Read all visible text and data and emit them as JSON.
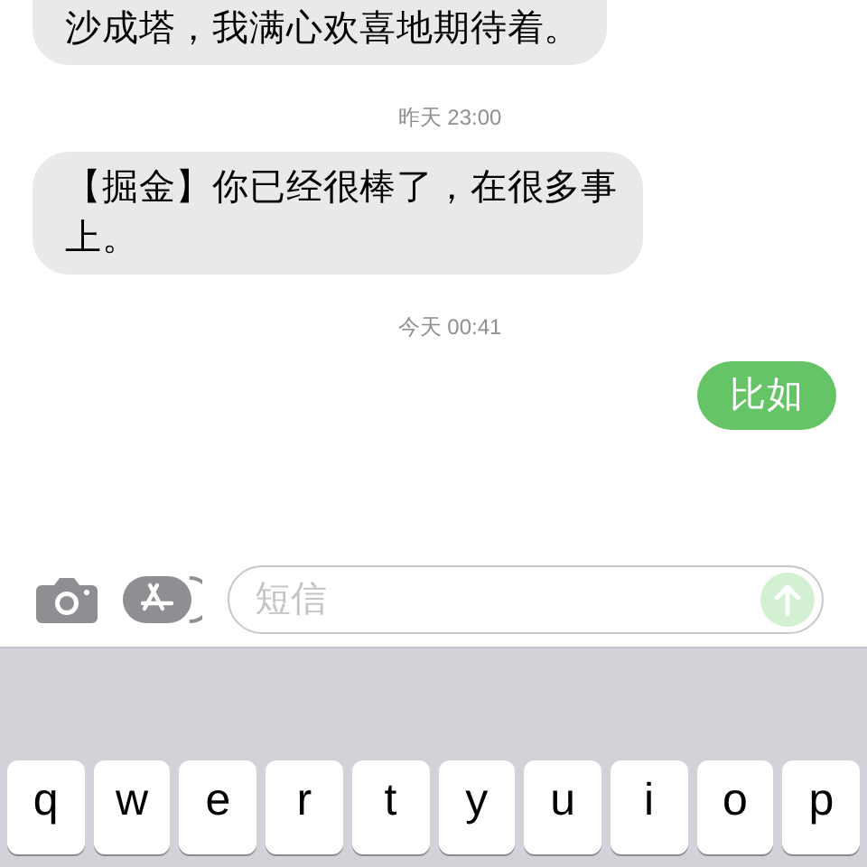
{
  "messages": [
    {
      "kind": "incoming",
      "text": "沙成塔，我满心欢喜地期待着。",
      "cut_top": true
    },
    {
      "kind": "timestamp",
      "text": "昨天 23:00"
    },
    {
      "kind": "incoming",
      "text": "【掘金】你已经很棒了，在很多事上。",
      "cut_top": false
    },
    {
      "kind": "timestamp",
      "text": "今天 00:41"
    },
    {
      "kind": "outgoing",
      "text": "比如"
    }
  ],
  "composer": {
    "placeholder": "短信",
    "send_disabled": true
  },
  "keyboard": {
    "keys": [
      "q",
      "w",
      "e",
      "r",
      "t",
      "y",
      "u",
      "i",
      "o",
      "p"
    ]
  }
}
